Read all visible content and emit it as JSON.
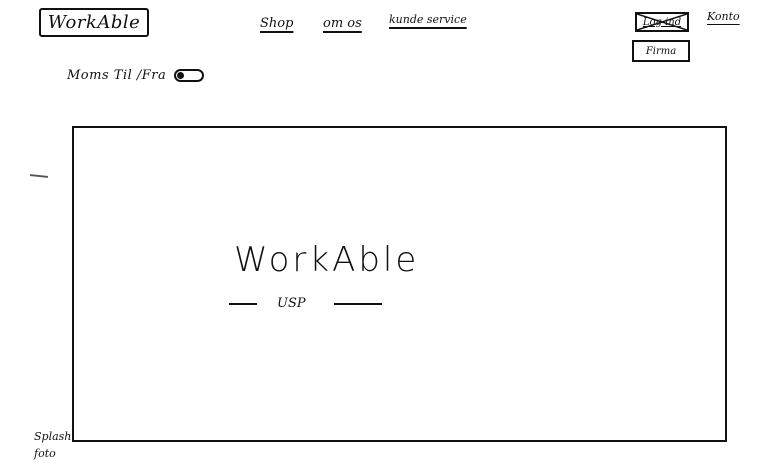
{
  "header": {
    "logo_text": "WorkAble",
    "nav": {
      "shop": "Shop",
      "om_os": "om os",
      "kundeservice": "kunde service"
    },
    "login_label": "Log ind",
    "konto_label": "Konto",
    "firma_label": "Firma"
  },
  "moms": {
    "label": "Moms Til /Fra"
  },
  "hero": {
    "title": "WorkAble",
    "usp": "USP"
  },
  "notes": {
    "splash_line1": "Splash",
    "splash_line2": "foto"
  }
}
